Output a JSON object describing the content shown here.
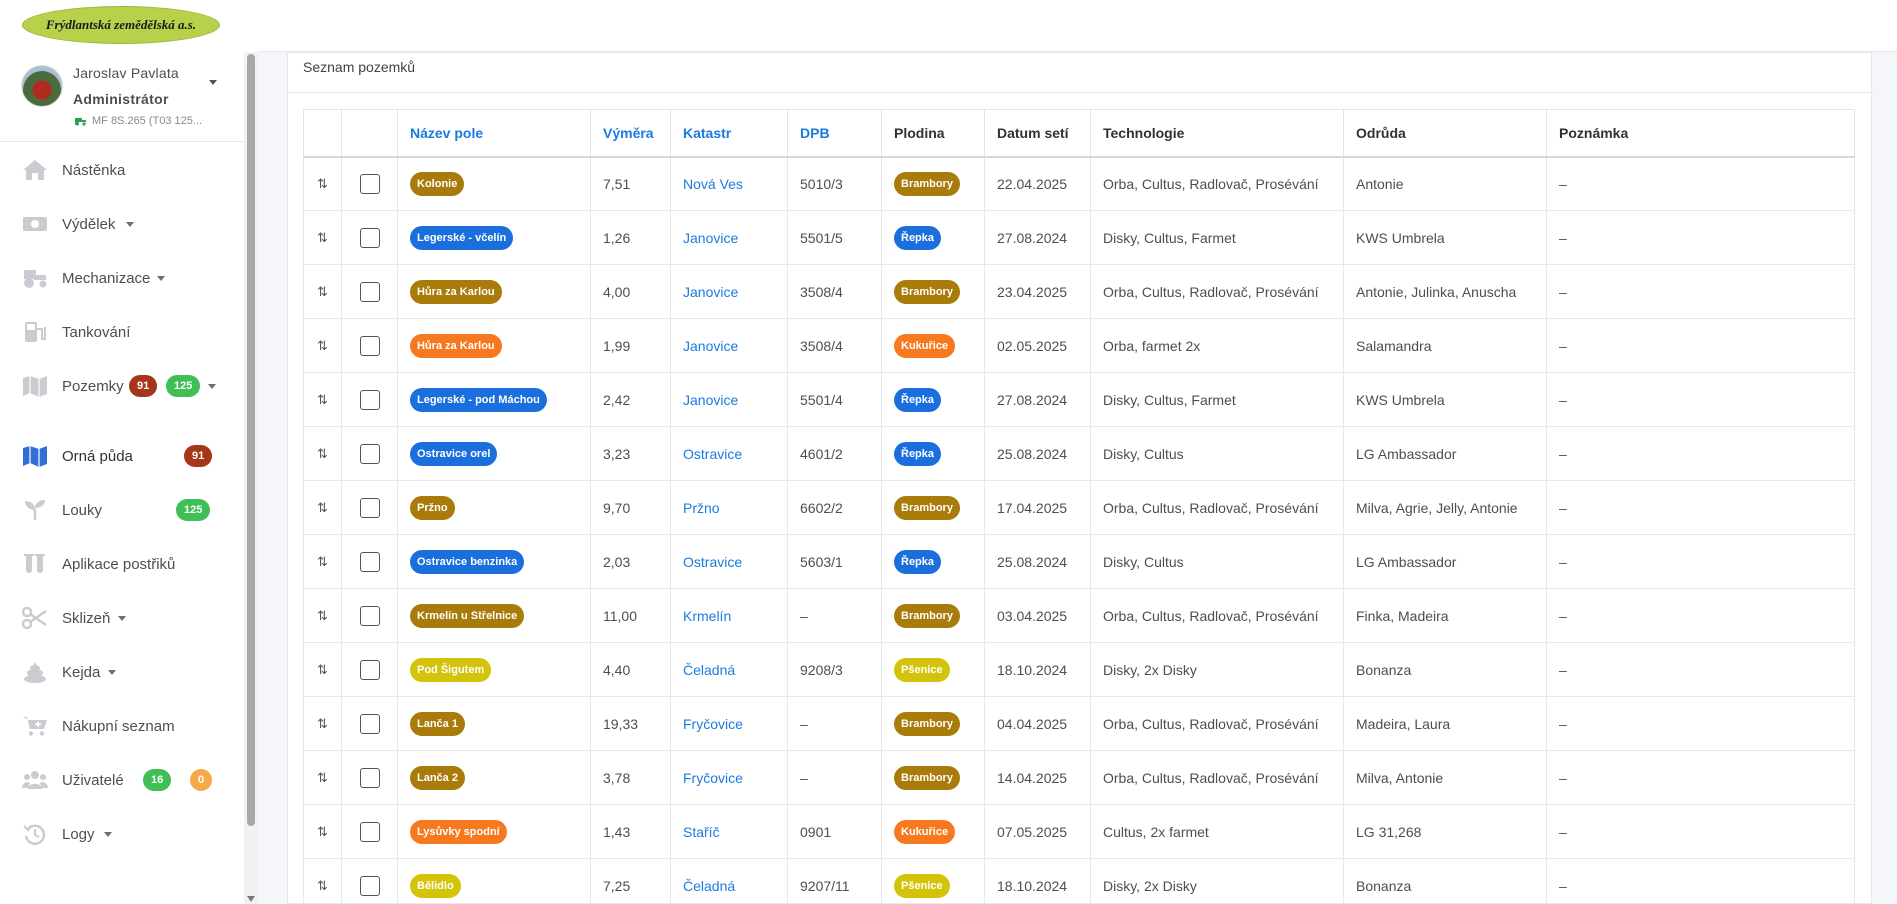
{
  "logo": {
    "text": "Frýdlantská zemědělská a.s."
  },
  "user": {
    "name": "Jaroslav Pavlata",
    "role": "Administrátor",
    "machine": "MF 8S.265 (T03 125..."
  },
  "nav": {
    "nastenka": "Nástěnka",
    "vydelek": "Výdělek",
    "mechanizace": "Mechanizace",
    "tankovani": "Tankování",
    "pozemky": "Pozemky",
    "pozemky_badge1": "91",
    "pozemky_badge2": "125",
    "orna_puda": "Orná půda",
    "orna_puda_badge": "91",
    "louky": "Louky",
    "louky_badge": "125",
    "aplikace": "Aplikace postřiků",
    "sklizen": "Sklizeň",
    "kejda": "Kejda",
    "nakupni": "Nákupní seznam",
    "uzivatele": "Uživatelé",
    "uzivatele_badge1": "16",
    "uzivatele_badge2": "0",
    "logy": "Logy"
  },
  "card": {
    "title": "Seznam pozemků"
  },
  "table": {
    "headers": {
      "nazev": "Název pole",
      "vymera": "Výměra",
      "katastr": "Katastr",
      "dpb": "DPB",
      "plodina": "Plodina",
      "datum": "Datum setí",
      "technologie": "Technologie",
      "odruda": "Odrůda",
      "poznamka": "Poznámka"
    },
    "drag_glyph": "⇅",
    "rows": [
      {
        "nazev": "Kolonie",
        "nazev_color": "#a87b0a",
        "vymera": "7,51",
        "katastr": "Nová Ves",
        "dpb": "5010/3",
        "plodina": "Brambory",
        "plodina_color": "#a87b0a",
        "datum": "22.04.2025",
        "technologie": "Orba, Cultus, Radlovač, Prosévání",
        "odruda": "Antonie",
        "poznamka": "–"
      },
      {
        "nazev": "Legerské - včelín",
        "nazev_color": "#1a6fdc",
        "vymera": "1,26",
        "katastr": "Janovice",
        "dpb": "5501/5",
        "plodina": "Řepka",
        "plodina_color": "#1a6fdc",
        "datum": "27.08.2024",
        "technologie": "Disky, Cultus, Farmet",
        "odruda": "KWS Umbrela",
        "poznamka": "–"
      },
      {
        "nazev": "Hůra za Karlou",
        "nazev_color": "#a87b0a",
        "vymera": "4,00",
        "katastr": "Janovice",
        "dpb": "3508/4",
        "plodina": "Brambory",
        "plodina_color": "#a87b0a",
        "datum": "23.04.2025",
        "technologie": "Orba, Cultus, Radlovač, Prosévání",
        "odruda": "Antonie, Julinka, Anuscha",
        "poznamka": "–"
      },
      {
        "nazev": "Hůra za Karlou",
        "nazev_color": "#f7791f",
        "vymera": "1,99",
        "katastr": "Janovice",
        "dpb": "3508/4",
        "plodina": "Kukuřice",
        "plodina_color": "#f7791f",
        "datum": "02.05.2025",
        "technologie": "Orba, farmet 2x",
        "odruda": "Salamandra",
        "poznamka": "–"
      },
      {
        "nazev": "Legerské - pod Máchou",
        "nazev_color": "#1a6fdc",
        "vymera": "2,42",
        "katastr": "Janovice",
        "dpb": "5501/4",
        "plodina": "Řepka",
        "plodina_color": "#1a6fdc",
        "datum": "27.08.2024",
        "technologie": "Disky, Cultus, Farmet",
        "odruda": "KWS Umbrela",
        "poznamka": "–"
      },
      {
        "nazev": "Ostravice orel",
        "nazev_color": "#1a6fdc",
        "vymera": "3,23",
        "katastr": "Ostravice",
        "dpb": "4601/2",
        "plodina": "Řepka",
        "plodina_color": "#1a6fdc",
        "datum": "25.08.2024",
        "technologie": "Disky, Cultus",
        "odruda": "LG Ambassador",
        "poznamka": "–"
      },
      {
        "nazev": "Pržno",
        "nazev_color": "#a87b0a",
        "vymera": "9,70",
        "katastr": "Pržno",
        "dpb": "6602/2",
        "plodina": "Brambory",
        "plodina_color": "#a87b0a",
        "datum": "17.04.2025",
        "technologie": "Orba, Cultus, Radlovač, Prosévání",
        "odruda": "Milva, Agrie, Jelly, Antonie",
        "poznamka": "–"
      },
      {
        "nazev": "Ostravice benzinka",
        "nazev_color": "#1a6fdc",
        "vymera": "2,03",
        "katastr": "Ostravice",
        "dpb": "5603/1",
        "plodina": "Řepka",
        "plodina_color": "#1a6fdc",
        "datum": "25.08.2024",
        "technologie": "Disky, Cultus",
        "odruda": "LG Ambassador",
        "poznamka": "–"
      },
      {
        "nazev": "Krmelín u Střelnice",
        "nazev_color": "#a87b0a",
        "vymera": "11,00",
        "katastr": "Krmelín",
        "dpb": "–",
        "plodina": "Brambory",
        "plodina_color": "#a87b0a",
        "datum": "03.04.2025",
        "technologie": "Orba, Cultus, Radlovač, Prosévání",
        "odruda": "Finka, Madeira",
        "poznamka": "–"
      },
      {
        "nazev": "Pod Šigutem",
        "nazev_color": "#d4c30b",
        "vymera": "4,40",
        "katastr": "Čeladná",
        "dpb": "9208/3",
        "plodina": "Pšenice",
        "plodina_color": "#d4c30b",
        "datum": "18.10.2024",
        "technologie": "Disky, 2x Disky",
        "odruda": "Bonanza",
        "poznamka": "–"
      },
      {
        "nazev": "Lanča 1",
        "nazev_color": "#a87b0a",
        "vymera": "19,33",
        "katastr": "Fryčovice",
        "dpb": "–",
        "plodina": "Brambory",
        "plodina_color": "#a87b0a",
        "datum": "04.04.2025",
        "technologie": "Orba, Cultus, Radlovač, Prosévání",
        "odruda": "Madeira, Laura",
        "poznamka": "–"
      },
      {
        "nazev": "Lanča 2",
        "nazev_color": "#a87b0a",
        "vymera": "3,78",
        "katastr": "Fryčovice",
        "dpb": "–",
        "plodina": "Brambory",
        "plodina_color": "#a87b0a",
        "datum": "14.04.2025",
        "technologie": "Orba, Cultus, Radlovač, Prosévání",
        "odruda": "Milva, Antonie",
        "poznamka": "–"
      },
      {
        "nazev": "Lysůvky spodní",
        "nazev_color": "#f7791f",
        "vymera": "1,43",
        "katastr": "Staříč",
        "dpb": "0901",
        "plodina": "Kukuřice",
        "plodina_color": "#f7791f",
        "datum": "07.05.2025",
        "technologie": "Cultus, 2x farmet",
        "odruda": "LG 31,268",
        "poznamka": "–"
      },
      {
        "nazev": "Bělidlo",
        "nazev_color": "#d4c30b",
        "vymera": "7,25",
        "katastr": "Čeladná",
        "dpb": "9207/11",
        "plodina": "Pšenice",
        "plodina_color": "#d4c30b",
        "datum": "18.10.2024",
        "technologie": "Disky, 2x Disky",
        "odruda": "Bonanza",
        "poznamka": "–"
      }
    ]
  }
}
